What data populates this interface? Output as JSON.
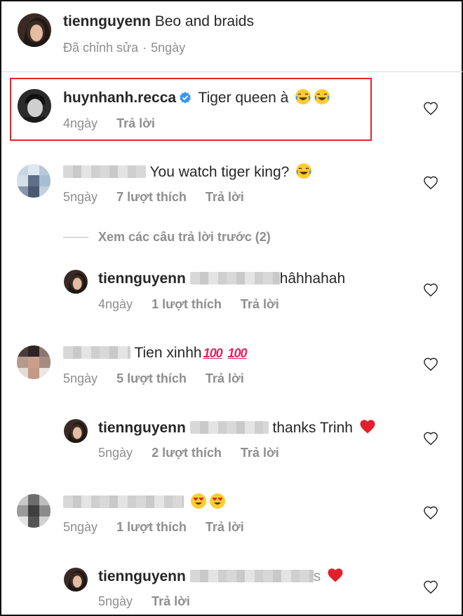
{
  "caption": {
    "username": "tiennguyenn",
    "text": "Beo and braids",
    "edited": "Đã chỉnh sửa",
    "separator": "·",
    "time": "5ngày"
  },
  "comments": [
    {
      "username": "huynhanh.recca",
      "verified": true,
      "text": "Tiger queen à",
      "emojis": [
        "tears-of-joy",
        "tears-of-joy"
      ],
      "time": "4ngày",
      "likes": "",
      "reply": "Trả lời",
      "highlighted": true
    },
    {
      "username": "",
      "text": "You watch tiger king?",
      "emojis": [
        "tears-of-joy"
      ],
      "time": "5ngày",
      "likes": "7 lượt thích",
      "reply": "Trả lời"
    },
    {
      "view_previous": "Xem các câu trả lời trước (2)"
    },
    {
      "username": "tiennguyenn",
      "text": "hâhhahah",
      "time": "4ngày",
      "likes": "1 lượt thích",
      "reply": "Trả lời",
      "is_reply": true
    },
    {
      "username": "",
      "text": "Tien xinhh",
      "emojis": [
        "hundred",
        "hundred"
      ],
      "hundred_glyph": "100",
      "time": "5ngày",
      "likes": "5 lượt thích",
      "reply": "Trả lời"
    },
    {
      "username": "tiennguyenn",
      "text": "thanks Trinh",
      "emojis": [
        "red-heart"
      ],
      "time": "5ngày",
      "likes": "2 lượt thích",
      "reply": "Trả lời",
      "is_reply": true
    },
    {
      "username": "",
      "text": "",
      "emojis": [
        "heart-eyes",
        "heart-eyes"
      ],
      "time": "5ngày",
      "likes": "1 lượt thích",
      "reply": "Trả lời"
    },
    {
      "username": "tiennguyenn",
      "text": "s",
      "emojis": [
        "red-heart"
      ],
      "time": "5ngày",
      "likes": "",
      "reply": "Trả lời",
      "is_reply": true
    }
  ],
  "colors": {
    "highlight_border": "#e3262a",
    "verified_blue": "#3897f0",
    "meta_gray": "#8e8e8e"
  }
}
